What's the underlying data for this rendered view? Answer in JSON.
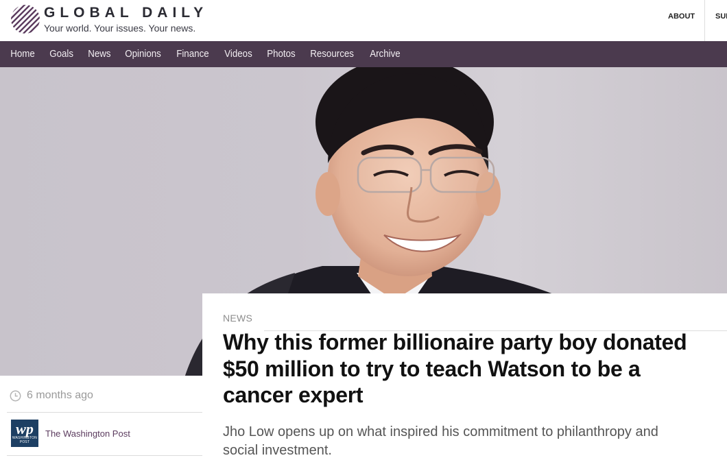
{
  "brand": {
    "name": "GLOBAL DAILY",
    "tagline": "Your world. Your issues. Your news."
  },
  "top_links": {
    "about": "ABOUT",
    "subscribe": "SUB"
  },
  "nav": {
    "items": [
      {
        "label": "Home"
      },
      {
        "label": "Goals"
      },
      {
        "label": "News"
      },
      {
        "label": "Opinions"
      },
      {
        "label": "Finance"
      },
      {
        "label": "Videos"
      },
      {
        "label": "Photos"
      },
      {
        "label": "Resources"
      },
      {
        "label": "Archive"
      }
    ]
  },
  "meta": {
    "time_ago": "6 months ago",
    "source_logo_text": "wp",
    "source_logo_subtext": "WASHINGTON POST",
    "source_name": "The Washington Post"
  },
  "article": {
    "kicker": "NEWS",
    "headline": "Why this former billionaire party boy donated $50 million to try to teach Watson to be a cancer expert",
    "dek": "Jho Low opens up on what inspired his commitment to philanthropy and social investment."
  },
  "colors": {
    "nav_bg": "#4b3a4e",
    "logo_stripe": "#5b3b5e",
    "source_link": "#5b3b5e"
  },
  "icons": {
    "logo": "striped-circle-logo-icon",
    "clock": "clock-icon"
  }
}
